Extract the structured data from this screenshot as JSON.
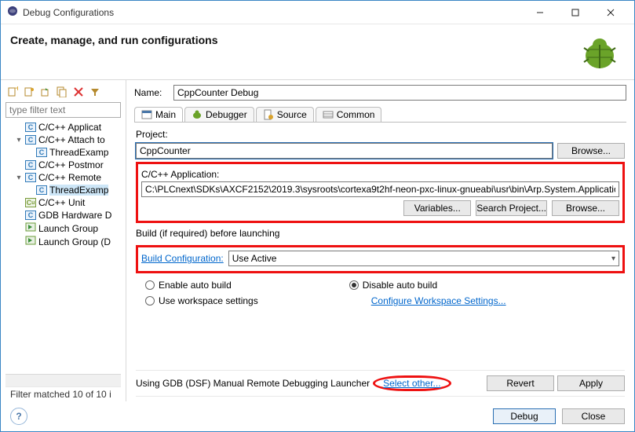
{
  "window": {
    "title": "Debug Configurations"
  },
  "header": {
    "title": "Create, manage, and run configurations",
    "subtitle": ""
  },
  "toolbar": {
    "new": "new-config",
    "duplicate": "duplicate",
    "export": "export",
    "delete": "delete",
    "filter": "filter"
  },
  "filter": {
    "placeholder": "type filter text"
  },
  "tree": [
    {
      "label": "C/C++ Applicat",
      "icon": "C",
      "expand": "",
      "indent": 1
    },
    {
      "label": "C/C++ Attach to",
      "icon": "C",
      "expand": "▾",
      "indent": 1
    },
    {
      "label": "ThreadExamp",
      "icon": "C",
      "expand": "",
      "indent": 2
    },
    {
      "label": "C/C++ Postmor",
      "icon": "C",
      "expand": "",
      "indent": 1
    },
    {
      "label": "C/C++ Remote",
      "icon": "C",
      "expand": "▾",
      "indent": 1
    },
    {
      "label": "ThreadExamp",
      "icon": "C",
      "expand": "",
      "indent": 2,
      "selected": true
    },
    {
      "label": "C/C++ Unit",
      "icon": "C",
      "iconColor": "#7a9b3a",
      "expand": "",
      "indent": 1
    },
    {
      "label": "GDB Hardware D",
      "icon": "C",
      "expand": "",
      "indent": 1
    },
    {
      "label": "Launch Group",
      "icon": "▶",
      "expand": "",
      "indent": 1
    },
    {
      "label": "Launch Group (D",
      "icon": "▶",
      "expand": "",
      "indent": 1
    }
  ],
  "status": "Filter matched 10 of 10 i",
  "form": {
    "name_label": "Name:",
    "name_value": "CppCounter Debug",
    "tabs": {
      "main": "Main",
      "debugger": "Debugger",
      "source": "Source",
      "common": "Common"
    },
    "project_label": "Project:",
    "project_value": "CppCounter",
    "browse": "Browse...",
    "app_label": "C/C++ Application:",
    "app_value": "C:\\PLCnext\\SDKs\\AXCF2152\\2019.3\\sysroots\\cortexa9t2hf-neon-pxc-linux-gnueabi\\usr\\bin\\Arp.System.Application",
    "variables": "Variables...",
    "search_project": "Search Project...",
    "build_group": "Build (if required) before launching",
    "build_config_label": "Build Configuration:",
    "build_config_value": "Use Active",
    "enable_auto": "Enable auto build",
    "disable_auto": "Disable auto build",
    "use_workspace": "Use workspace settings",
    "configure_ws": "Configure Workspace Settings...",
    "launcher_text": "Using GDB (DSF) Manual Remote Debugging Launcher",
    "select_other": "Select other...",
    "revert": "Revert",
    "apply": "Apply"
  },
  "footer": {
    "debug": "Debug",
    "close": "Close"
  }
}
